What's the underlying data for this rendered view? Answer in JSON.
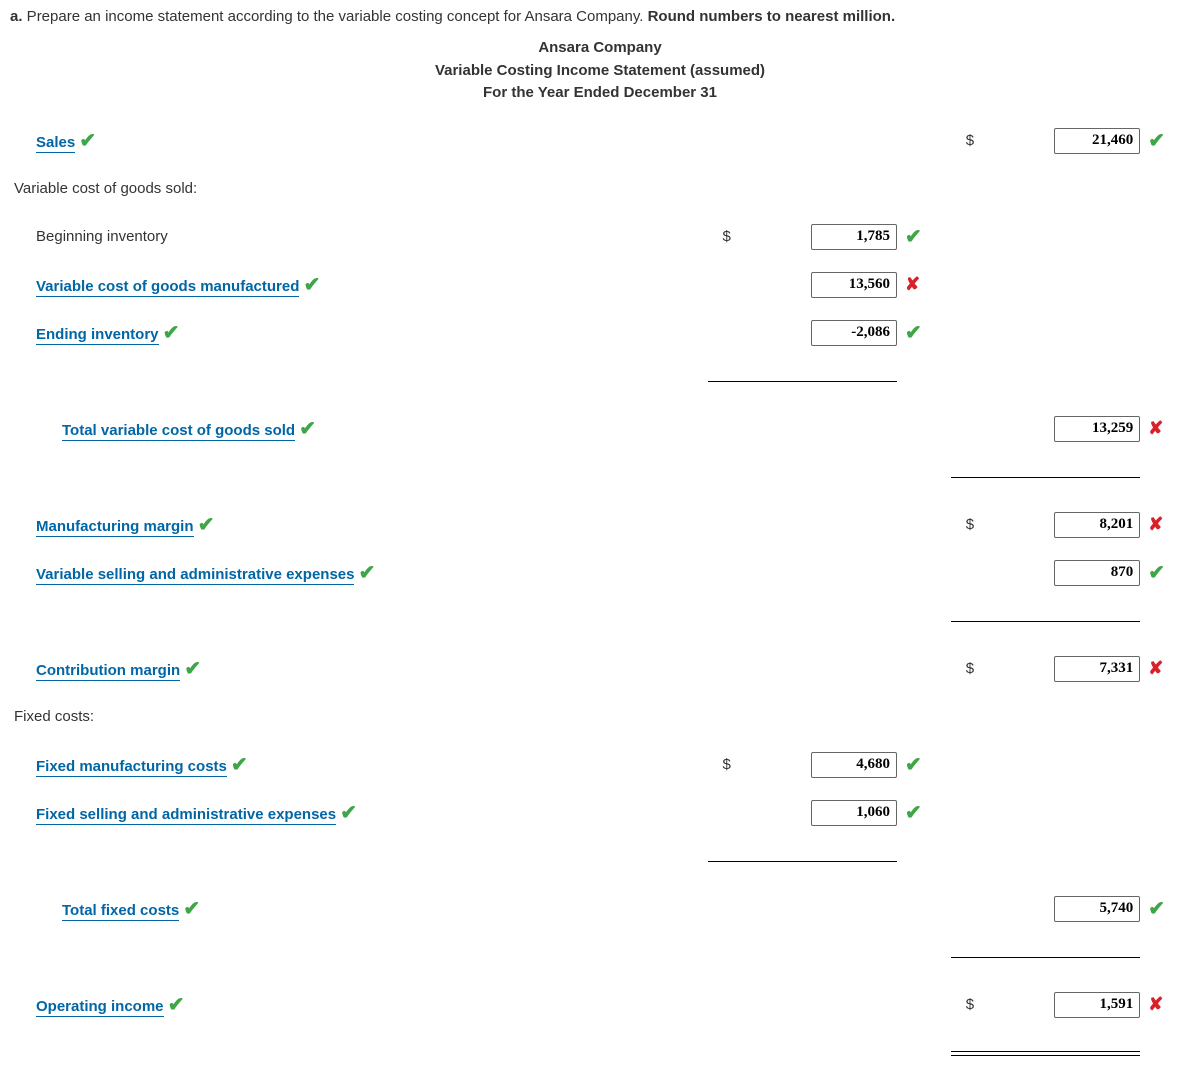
{
  "prompt": {
    "letter": "a.",
    "text": " Prepare an income statement according to the variable costing concept for Ansara Company. ",
    "bold_tail": "Round numbers to nearest million."
  },
  "header": {
    "company": "Ansara Company",
    "title": "Variable Costing Income Statement (assumed)",
    "period": "For the Year Ended December 31"
  },
  "rows": {
    "sales": {
      "label": "Sales",
      "value": "21,460",
      "dollar": "$",
      "mark": "check",
      "label_mark": "check"
    },
    "vcogs_header": {
      "label": "Variable cost of goods sold:"
    },
    "beg_inv": {
      "label": "Beginning inventory",
      "value": "1,785",
      "dollar": "$",
      "mark": "check"
    },
    "vcogm": {
      "label": "Variable cost of goods manufactured",
      "value": "13,560",
      "mark": "cross",
      "label_mark": "check"
    },
    "end_inv": {
      "label": "Ending inventory",
      "value": "-2,086",
      "mark": "check",
      "label_mark": "check"
    },
    "tot_vcogs": {
      "label": "Total variable cost of goods sold",
      "value": "13,259",
      "mark": "cross",
      "label_mark": "check"
    },
    "mfg_margin": {
      "label": "Manufacturing margin",
      "value": "8,201",
      "dollar": "$",
      "mark": "cross",
      "label_mark": "check"
    },
    "var_sell": {
      "label": "Variable selling and administrative expenses",
      "value": "870",
      "mark": "check",
      "label_mark": "check"
    },
    "contrib": {
      "label": "Contribution margin",
      "value": "7,331",
      "dollar": "$",
      "mark": "cross",
      "label_mark": "check"
    },
    "fixed_header": {
      "label": "Fixed costs:"
    },
    "fixed_mfg": {
      "label": "Fixed manufacturing costs",
      "value": "4,680",
      "dollar": "$",
      "mark": "check",
      "label_mark": "check"
    },
    "fixed_sell": {
      "label": "Fixed selling and administrative expenses",
      "value": "1,060",
      "mark": "check",
      "label_mark": "check"
    },
    "tot_fixed": {
      "label": "Total fixed costs",
      "value": "5,740",
      "mark": "check",
      "label_mark": "check"
    },
    "op_inc": {
      "label": "Operating income",
      "value": "1,591",
      "dollar": "$",
      "mark": "cross",
      "label_mark": "check"
    }
  },
  "glyphs": {
    "check": "✔",
    "cross": "✘"
  }
}
